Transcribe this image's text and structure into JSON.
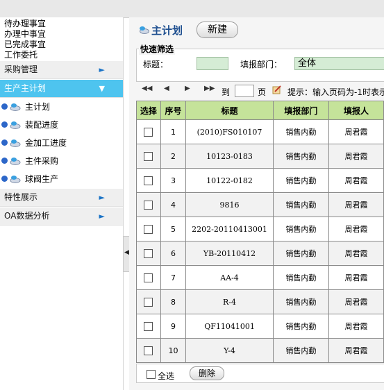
{
  "sidebar": {
    "todos": [
      "待办理事宜",
      "办理中事宜",
      "已完成事宜",
      "工作委托"
    ],
    "sections": [
      {
        "label": "采购管理",
        "active": false
      },
      {
        "label": "生产主计划",
        "active": true,
        "items": [
          "主计划",
          "装配进度",
          "金加工进度",
          "主件采购",
          "球阀生产"
        ]
      },
      {
        "label": "特性展示",
        "active": false
      },
      {
        "label": "OA数据分析",
        "active": false
      }
    ]
  },
  "main": {
    "title": "主计划",
    "new_button": "新建",
    "filter": {
      "legend": "快速筛选",
      "title_label": "标题：",
      "title_value": "",
      "dept_label": "填报部门：",
      "dept_value": "全体"
    },
    "pager": {
      "to_label": "到",
      "page_label": "页",
      "page_value": "",
      "hint": "提示：输入页码为-1时表示"
    },
    "table": {
      "headers": [
        "选择",
        "序号",
        "标题",
        "填报部门",
        "填报人"
      ],
      "rows": [
        {
          "no": "1",
          "title": "(2010)FS010107",
          "dept": "销售内勤",
          "person": "周君霞"
        },
        {
          "no": "2",
          "title": "10123-0183",
          "dept": "销售内勤",
          "person": "周君霞"
        },
        {
          "no": "3",
          "title": "10122-0182",
          "dept": "销售内勤",
          "person": "周君霞"
        },
        {
          "no": "4",
          "title": "9816",
          "dept": "销售内勤",
          "person": "周君霞"
        },
        {
          "no": "5",
          "title": "2202-20110413001",
          "dept": "销售内勤",
          "person": "周君霞"
        },
        {
          "no": "6",
          "title": "YB-20110412",
          "dept": "销售内勤",
          "person": "周君霞"
        },
        {
          "no": "7",
          "title": "AA-4",
          "dept": "销售内勤",
          "person": "周君霞"
        },
        {
          "no": "8",
          "title": "R-4",
          "dept": "销售内勤",
          "person": "周君霞"
        },
        {
          "no": "9",
          "title": "QF11041001",
          "dept": "销售内勤",
          "person": "周君霞"
        },
        {
          "no": "10",
          "title": "Y-4",
          "dept": "销售内勤",
          "person": "周君霞"
        }
      ]
    },
    "footer": {
      "select_all": "全选",
      "delete_button": "删除"
    }
  },
  "colors": {
    "active_section": "#4ec4ef",
    "table_header": "#c5e39a",
    "input_bg": "#d5ecd5",
    "title_blue": "#1d4e8f"
  }
}
